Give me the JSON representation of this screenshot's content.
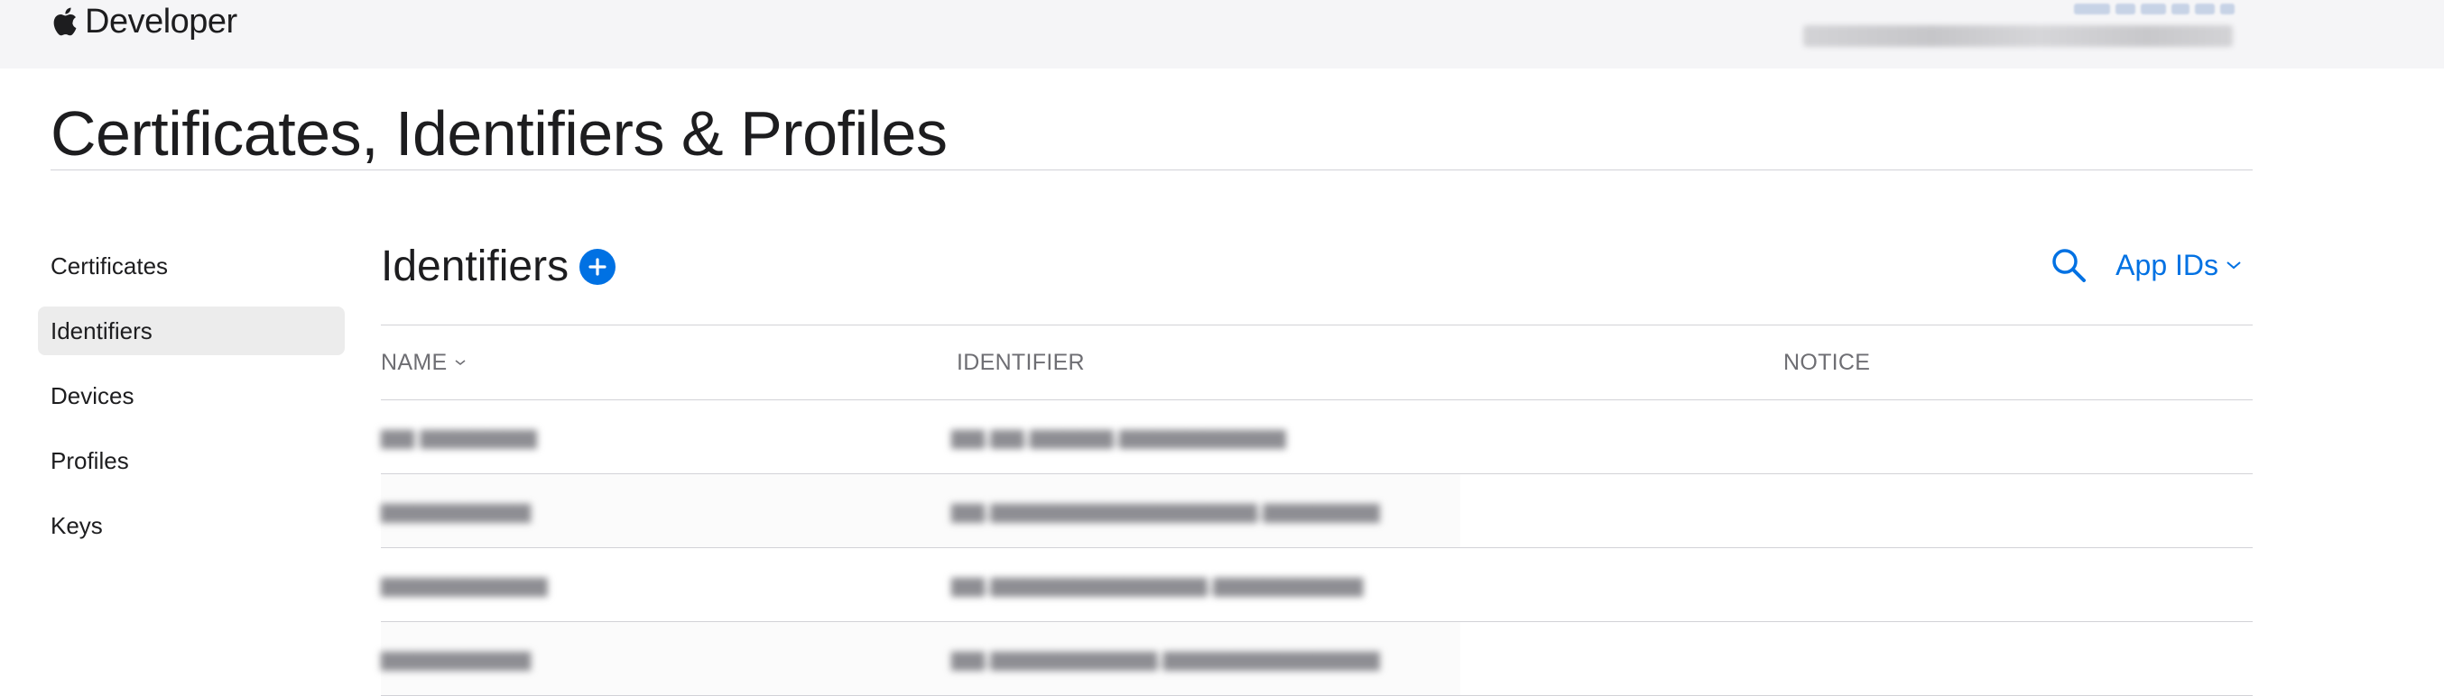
{
  "header": {
    "brand": "Developer",
    "account_name": "",
    "team_name": ""
  },
  "page": {
    "title": "Certificates, Identifiers & Profiles"
  },
  "sidebar": {
    "items": [
      {
        "label": "Certificates",
        "active": false
      },
      {
        "label": "Identifiers",
        "active": true
      },
      {
        "label": "Devices",
        "active": false
      },
      {
        "label": "Profiles",
        "active": false
      },
      {
        "label": "Keys",
        "active": false
      }
    ]
  },
  "main": {
    "section_title": "Identifiers",
    "filter_label": "App IDs"
  },
  "table": {
    "columns": [
      "NAME",
      "IDENTIFIER",
      "NOTICE"
    ],
    "rows": [
      {
        "name": "",
        "identifier": "",
        "notice": ""
      },
      {
        "name": "",
        "identifier": "",
        "notice": ""
      },
      {
        "name": "",
        "identifier": "",
        "notice": ""
      },
      {
        "name": "",
        "identifier": "",
        "notice": ""
      }
    ]
  },
  "colors": {
    "accent": "#0071e3",
    "header_bg": "#f5f5f7",
    "active_item_bg": "#ececec",
    "rule": "#d2d2d7",
    "muted_text": "#6e6e73"
  },
  "icons": {
    "brand": "apple-logo-icon",
    "add": "plus-circle-icon",
    "search": "search-icon",
    "filter_chevron": "chevron-down-icon",
    "sort_chevron": "chevron-down-icon"
  }
}
